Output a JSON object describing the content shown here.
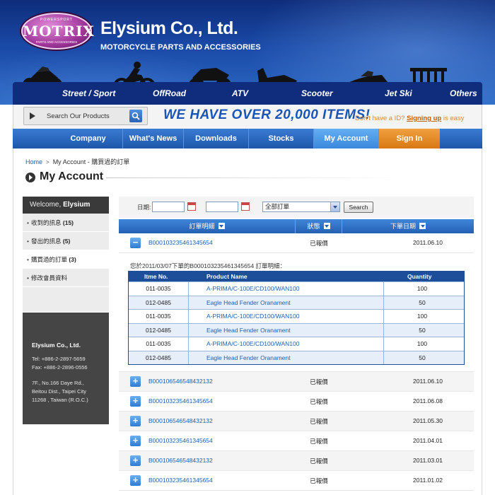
{
  "brand": {
    "logo_top": "POWERSPORT",
    "logo_main": "MOTRIX",
    "logo_sub": "PARTS AND ACCESSORIES",
    "company_name": "Elysium Co., Ltd.",
    "tagline": "MOTORCYCLE PARTS AND ACCESSORIES"
  },
  "categories": [
    {
      "label": "Street / Sport",
      "icon": "street-bike-icon"
    },
    {
      "label": "OffRoad",
      "icon": "dirt-bike-icon"
    },
    {
      "label": "ATV",
      "icon": "atv-icon"
    },
    {
      "label": "Scooter",
      "icon": "scooter-icon"
    },
    {
      "label": "Jet Ski",
      "icon": "jet-ski-icon"
    },
    {
      "label": "Others",
      "icon": "exhaust-pipes-icon"
    }
  ],
  "search": {
    "placeholder": "Search Our Products",
    "button_icon": "search-icon"
  },
  "promo": "WE HAVE OVER 20,000 ITEMS!",
  "signup": {
    "text": "Don't have a ID?",
    "link": "Signing up",
    "suffix": "is easy"
  },
  "nav": {
    "items": [
      {
        "label": "Company"
      },
      {
        "label": "What's News"
      },
      {
        "label": "Downloads"
      },
      {
        "label": "Stocks"
      },
      {
        "label": "My Account"
      },
      {
        "label": "Sign In"
      }
    ]
  },
  "breadcrumb": {
    "home": "Home",
    "current": "My Account - 購買過的訂單"
  },
  "page_title": "My Account",
  "sidebar": {
    "welcome": "Welcome,",
    "user": "Elysium",
    "items": [
      {
        "label": "收到的訊息",
        "count": "(15)"
      },
      {
        "label": "發出的訊息",
        "count": "(5)"
      },
      {
        "label": "購買過的訂單",
        "count": "(3)"
      },
      {
        "label": "修改會員資料",
        "count": ""
      }
    ],
    "contact": {
      "name": "Elysium Co., Ltd.",
      "tel": "Tel: +886-2-2897-5659",
      "fax": "Fax: +886-2-2896-0556",
      "addr1": "7F., No.166 Daye Rd.,",
      "addr2": "Beitou Dist., Taipei City",
      "addr3": "11268 , Taiwan (R.O.C.)"
    }
  },
  "filter": {
    "date_label": "日期:",
    "tilde": "~",
    "select_value": "全部訂單",
    "search_label": "Search"
  },
  "orders": {
    "headers": {
      "order": "訂單明細",
      "status": "狀態",
      "date": "下單日期"
    },
    "expanded": {
      "id": "B000103235461345654",
      "status": "已報價",
      "date": "2011.06.10",
      "caption": "您於2011/03/07下單的B000103235461345654 訂單明細：",
      "columns": {
        "item": "Itme No.",
        "name": "Product Name",
        "qty": "Quantity"
      },
      "lines": [
        {
          "item": "011-0035",
          "name": "A-PRIMA/C-100E/CD100/WAN100",
          "qty": "100"
        },
        {
          "item": "012-0485",
          "name": "Eagle Head Fender Oranament",
          "qty": "50"
        },
        {
          "item": "011-0035",
          "name": "A-PRIMA/C-100E/CD100/WAN100",
          "qty": "100"
        },
        {
          "item": "012-0485",
          "name": "Eagle Head Fender Oranament",
          "qty": "50"
        },
        {
          "item": "011-0035",
          "name": "A-PRIMA/C-100E/CD100/WAN100",
          "qty": "100"
        },
        {
          "item": "012-0485",
          "name": "Eagle Head Fender Oranament",
          "qty": "50"
        }
      ]
    },
    "rows": [
      {
        "id": "B000106546548432132",
        "status": "已報價",
        "date": "2011.06.10"
      },
      {
        "id": "B000103235461345654",
        "status": "已報價",
        "date": "2011.06.08"
      },
      {
        "id": "B000106546548432132",
        "status": "已報價",
        "date": "2011.05.30"
      },
      {
        "id": "B000103235461345654",
        "status": "已報價",
        "date": "2011.04.01"
      },
      {
        "id": "B000106546548432132",
        "status": "已報價",
        "date": "2011.03.01"
      },
      {
        "id": "B000103235461345654",
        "status": "已報價",
        "date": "2011.01.02"
      }
    ]
  }
}
